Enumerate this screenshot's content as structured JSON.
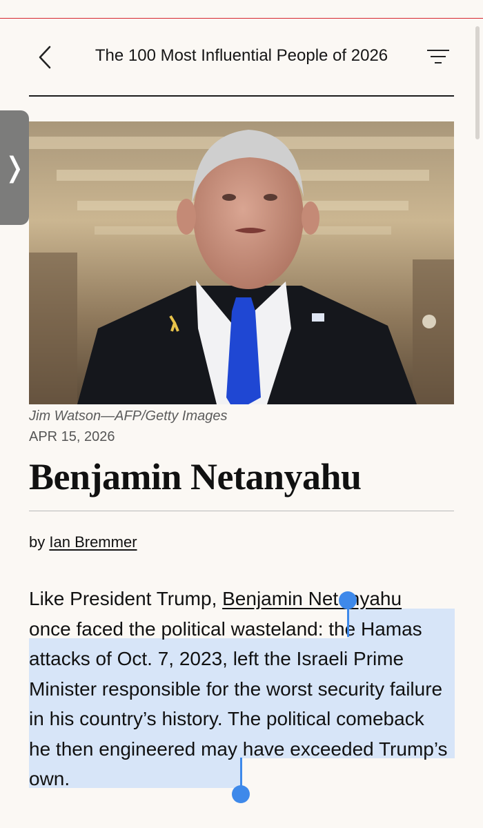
{
  "header": {
    "title": "The 100 Most Influential People of 2026",
    "back_icon": "chevron-left-icon",
    "menu_icon": "filter-menu-icon"
  },
  "side_tab": {
    "glyph": "❭",
    "icon": "chevron-right-icon"
  },
  "photo": {
    "credit": "Jim Watson—AFP/Getty Images"
  },
  "article": {
    "date": "APR 15, 2026",
    "headline": "Benjamin Netanyahu",
    "byline_prefix": "by",
    "author": "Ian Bremmer",
    "body_line1_pre": "Like President Trump, ",
    "body_link": "Benjamin Netanyahu",
    "body_line2": "once faced the political wasteland: ",
    "body_selected": "the Hamas attacks of Oct. 7, 2023, left the Israeli Prime Minister responsible for the worst security failure in his country’s history. The political comeback he then engineered may have exceeded Trump’s own."
  },
  "colors": {
    "accent_red": "#d6252f",
    "selection": "#d7e5f8",
    "handle": "#3e89ea",
    "background": "#fbf8f4"
  }
}
